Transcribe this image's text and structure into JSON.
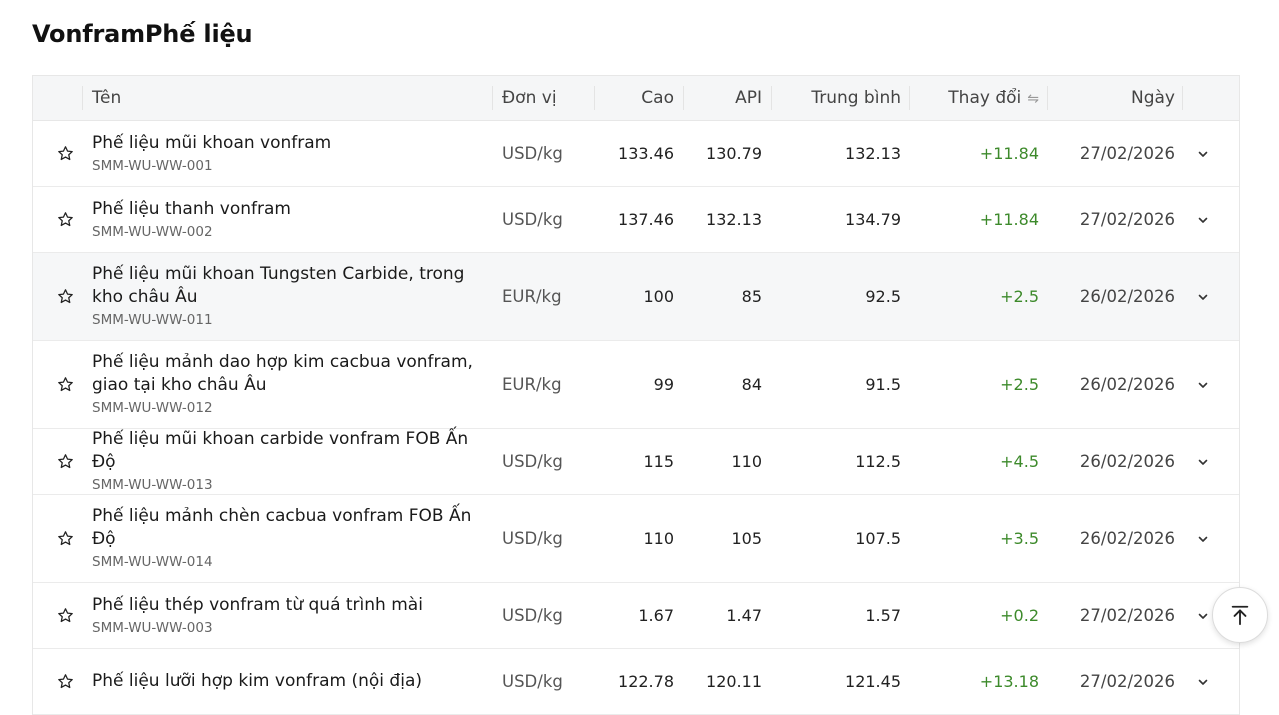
{
  "page": {
    "title": "VonframPhế liệu"
  },
  "table": {
    "headers": {
      "name": "Tên",
      "unit": "Đơn vị",
      "high": "Cao",
      "api": "API",
      "avg": "Trung bình",
      "change": "Thay đổi",
      "date": "Ngày"
    },
    "rows": [
      {
        "name": "Phế liệu mũi khoan vonfram",
        "code": "SMM-WU-WW-001",
        "unit": "USD/kg",
        "high": "133.46",
        "api": "130.79",
        "avg": "132.13",
        "change": "+11.84",
        "date": "27/02/2026"
      },
      {
        "name": "Phế liệu thanh vonfram",
        "code": "SMM-WU-WW-002",
        "unit": "USD/kg",
        "high": "137.46",
        "api": "132.13",
        "avg": "134.79",
        "change": "+11.84",
        "date": "27/02/2026"
      },
      {
        "name": "Phế liệu mũi khoan Tungsten Carbide, trong kho châu Âu",
        "code": "SMM-WU-WW-011",
        "unit": "EUR/kg",
        "high": "100",
        "api": "85",
        "avg": "92.5",
        "change": "+2.5",
        "date": "26/02/2026"
      },
      {
        "name": "Phế liệu mảnh dao hợp kim cacbua vonfram, giao tại kho châu Âu",
        "code": "SMM-WU-WW-012",
        "unit": "EUR/kg",
        "high": "99",
        "api": "84",
        "avg": "91.5",
        "change": "+2.5",
        "date": "26/02/2026"
      },
      {
        "name": "Phế liệu mũi khoan carbide vonfram FOB Ấn Độ",
        "code": "SMM-WU-WW-013",
        "unit": "USD/kg",
        "high": "115",
        "api": "110",
        "avg": "112.5",
        "change": "+4.5",
        "date": "26/02/2026"
      },
      {
        "name": "Phế liệu mảnh chèn cacbua vonfram FOB Ấn Độ",
        "code": "SMM-WU-WW-014",
        "unit": "USD/kg",
        "high": "110",
        "api": "105",
        "avg": "107.5",
        "change": "+3.5",
        "date": "26/02/2026"
      },
      {
        "name": "Phế liệu thép vonfram từ quá trình mài",
        "code": "SMM-WU-WW-003",
        "unit": "USD/kg",
        "high": "1.67",
        "api": "1.47",
        "avg": "1.57",
        "change": "+0.2",
        "date": "27/02/2026"
      },
      {
        "name": "Phế liệu lưỡi hợp kim vonfram (nội địa)",
        "code": "",
        "unit": "USD/kg",
        "high": "122.78",
        "api": "120.11",
        "avg": "121.45",
        "change": "+13.18",
        "date": "27/02/2026"
      }
    ]
  },
  "colors": {
    "change_positive": "#3d8a2b",
    "header_bg": "#f5f6f7",
    "highlight_row_bg": "#f6f7f8"
  },
  "icons": {
    "row_favorite": "star-outline-icon",
    "row_expand": "chevron-down-icon",
    "sort": "swap-arrows-icon",
    "scroll_top": "arrow-up-to-line-icon"
  }
}
